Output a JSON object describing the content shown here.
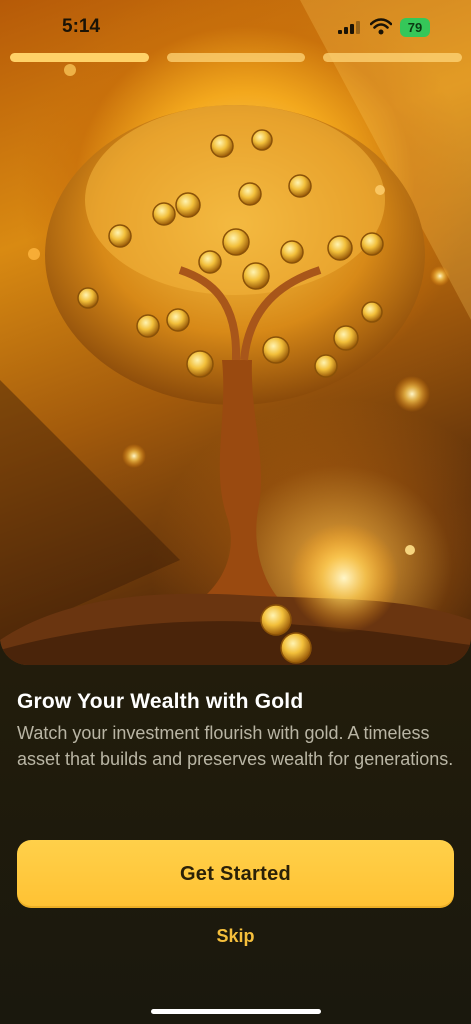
{
  "status_bar": {
    "time": "5:14",
    "battery": "79"
  },
  "onboarding": {
    "steps_total": 3,
    "current_step": 1,
    "title": "Grow Your Wealth with Gold",
    "description": "Watch your investment flourish with gold. A timeless asset that builds and preserves wealth for generations.",
    "primary_button": "Get Started",
    "secondary_link": "Skip"
  },
  "colors": {
    "accent": "#ffc233",
    "skip": "#f5bf3c",
    "background": "#231d0c"
  },
  "icons": [
    "cellular-signal-icon",
    "wifi-icon",
    "battery-icon"
  ]
}
